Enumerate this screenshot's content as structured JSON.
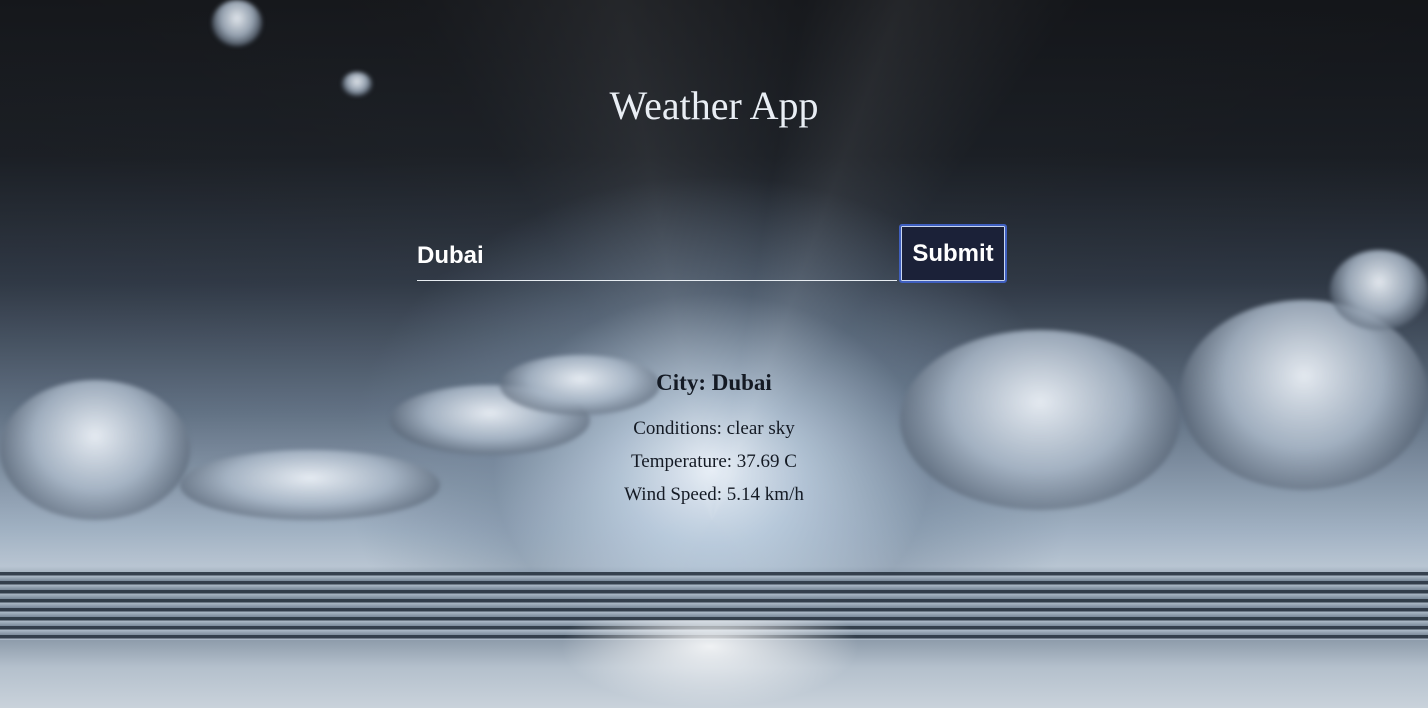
{
  "app": {
    "title": "Weather App"
  },
  "search": {
    "value": "Dubai",
    "submit_label": "Submit"
  },
  "weather": {
    "city_label": "City: Dubai",
    "conditions": "Conditions: clear sky",
    "temperature": "Temperature: 37.69 C",
    "wind_speed": "Wind Speed: 5.14 km/h"
  },
  "colors": {
    "button_bg": "#1b2138",
    "button_border": "#3f5fbf",
    "text_light": "#e9eef4",
    "text_dark": "#141a24"
  }
}
